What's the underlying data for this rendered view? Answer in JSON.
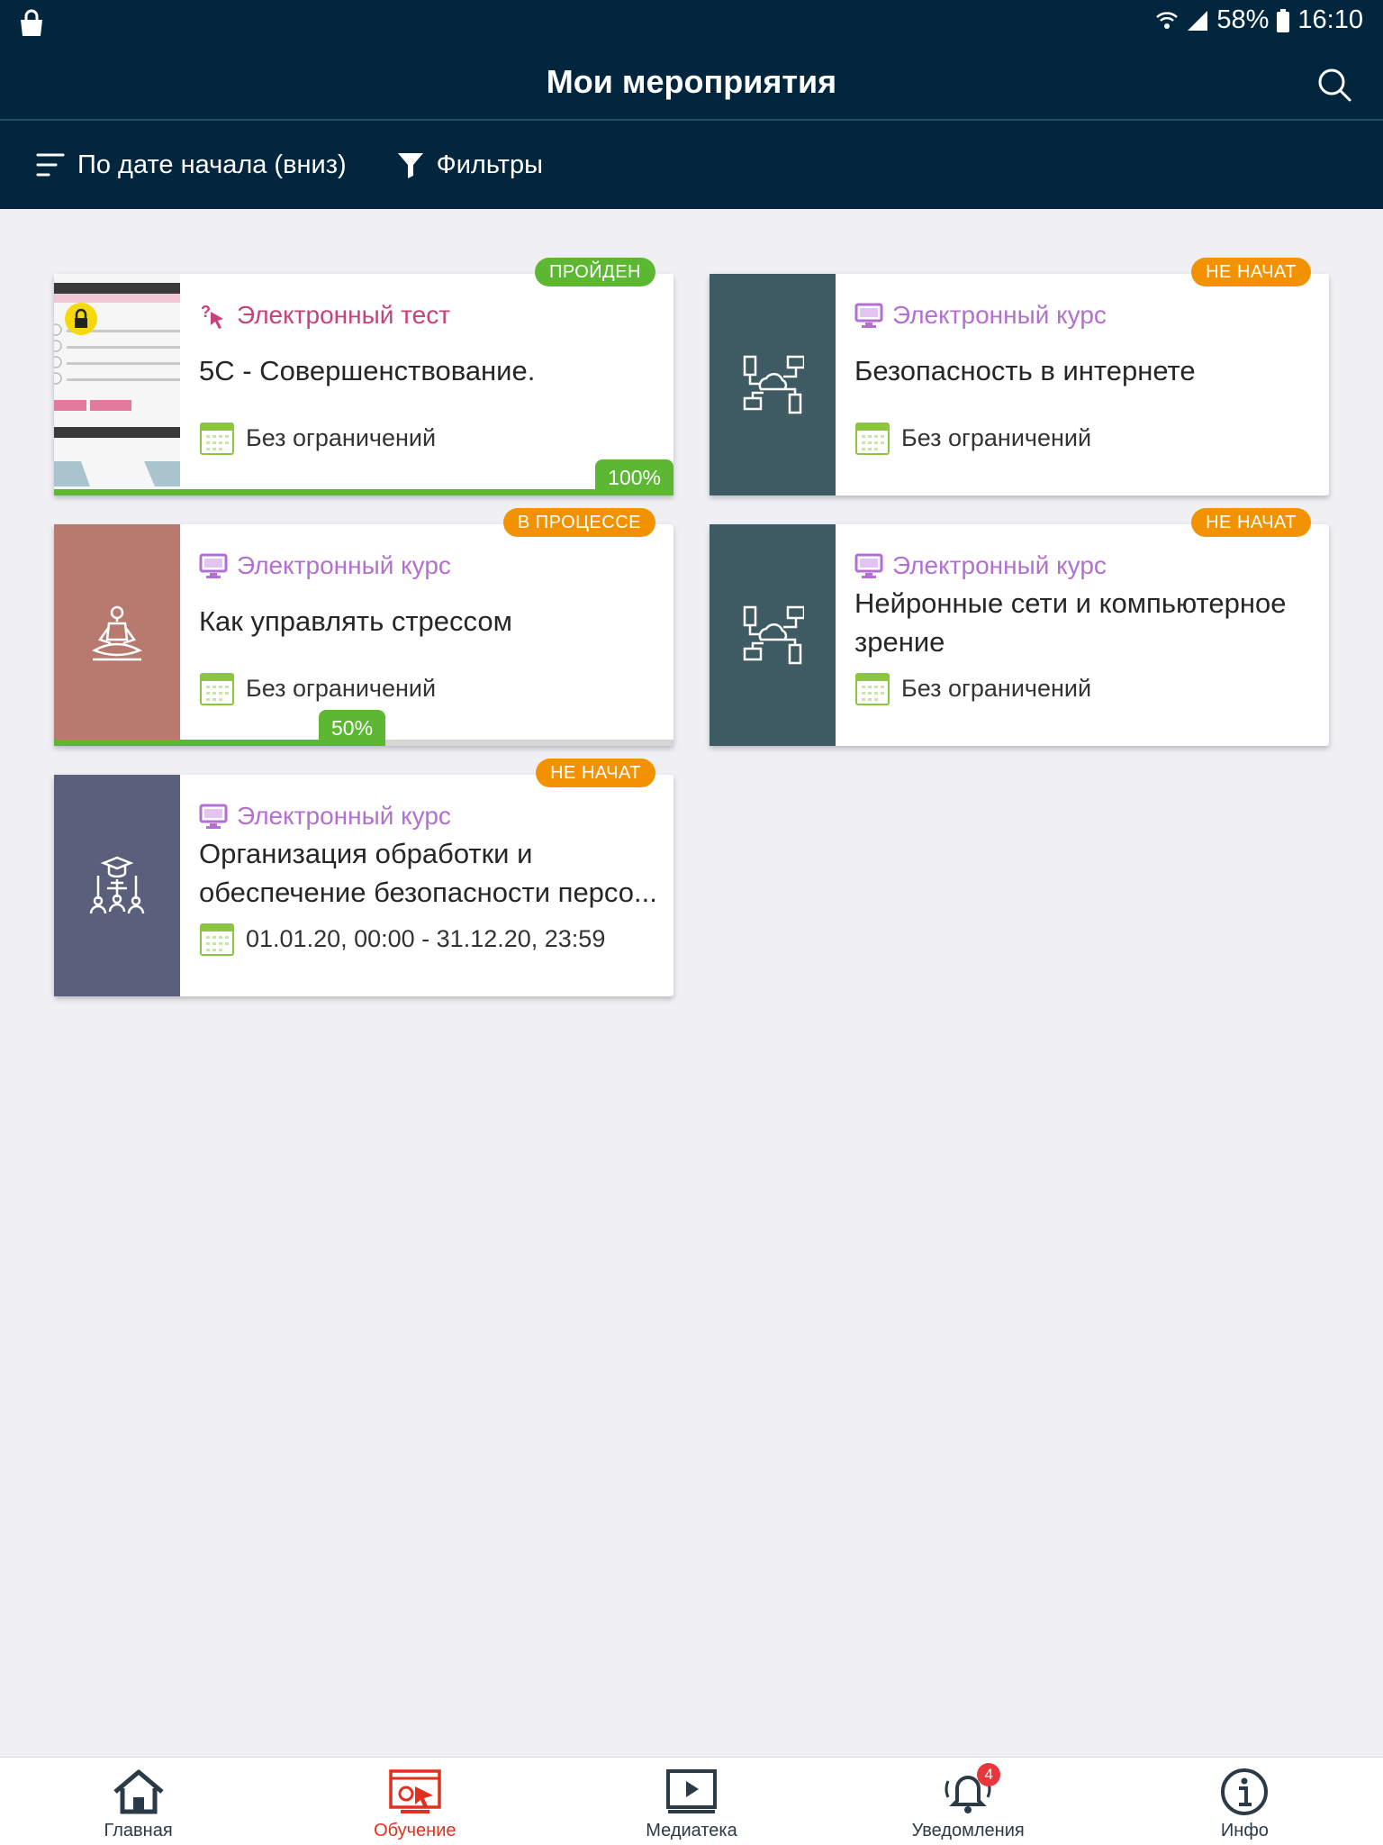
{
  "status_bar": {
    "battery": "58%",
    "time": "16:10"
  },
  "header": {
    "title": "Мои мероприятия"
  },
  "toolbar": {
    "sort_label": "По дате начала (вниз)",
    "filter_label": "Фильтры"
  },
  "cards": [
    {
      "type": "Электронный тест",
      "title": "5С - Совершенствование.",
      "date": "Без ограничений",
      "status": "ПРОЙДЕН",
      "progress_label": "100%",
      "progress": 1.0,
      "type_color": "#c8417c",
      "thumb": "test-screenshot"
    },
    {
      "type": "Электронный курс",
      "title": "Безопасность в интернете",
      "date": "Без ограничений",
      "status": "НЕ НАЧАТ",
      "type_color": "#b36fd2",
      "thumb": "network-cloud-icon"
    },
    {
      "type": "Электронный курс",
      "title": "Как управлять стрессом",
      "date": "Без ограничений",
      "status": "В ПРОЦЕССЕ",
      "progress_label": "50%",
      "progress": 0.5,
      "type_color": "#b36fd2",
      "thumb": "meditation-icon"
    },
    {
      "type": "Электронный курс",
      "title": "Нейронные сети и компьютерное зрение",
      "date": "Без ограничений",
      "status": "НЕ НАЧАТ",
      "type_color": "#b36fd2",
      "thumb": "network-cloud-icon"
    },
    {
      "type": "Электронный курс",
      "title": "Организация обработки и обеспечение безопасности персо...",
      "date": "01.01.20, 00:00 - 31.12.20, 23:59",
      "status": "НЕ НАЧАТ",
      "type_color": "#b36fd2",
      "thumb": "people-education-icon"
    }
  ],
  "bottom_nav": {
    "items": [
      {
        "label": "Главная",
        "icon": "home-icon"
      },
      {
        "label": "Обучение",
        "icon": "learning-icon",
        "active": true
      },
      {
        "label": "Медиатека",
        "icon": "media-library-icon"
      },
      {
        "label": "Уведомления",
        "icon": "bell-icon",
        "badge": "4"
      },
      {
        "label": "Инфо",
        "icon": "info-icon"
      }
    ]
  },
  "colors": {
    "header_bg": "#03263f",
    "page_bg": "#efeff4",
    "green": "#5cb832",
    "orange": "#f39200",
    "course_purple": "#b36fd2",
    "test_pink": "#c8417c",
    "thumb_slate": "#3e5a63",
    "thumb_terracotta": "#b87a6e",
    "thumb_indigo": "#5a607c",
    "nav_active": "#e0301e"
  }
}
